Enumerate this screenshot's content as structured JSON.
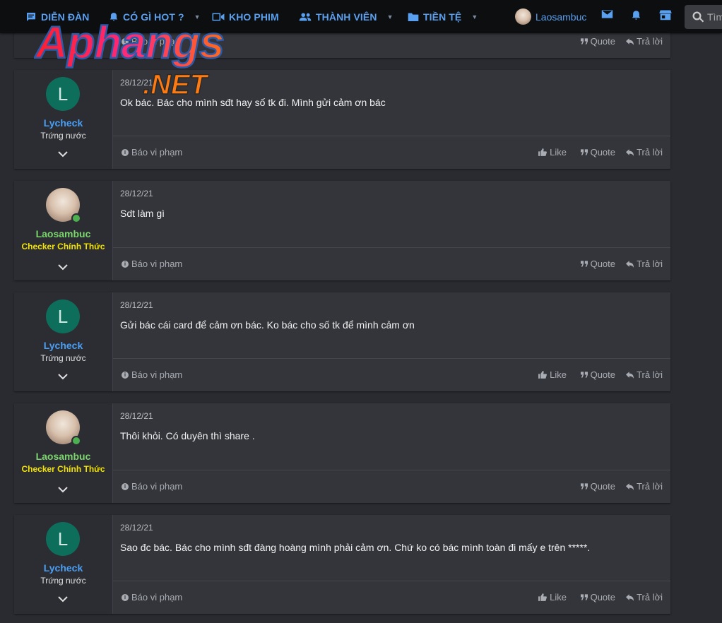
{
  "nav": {
    "forums": "DIỄN ĐÀN",
    "whats_hot": "CÓ GÌ HOT ?",
    "movies": "KHO PHIM",
    "members": "THÀNH VIÊN",
    "currency": "TIỀN TỆ",
    "username": "Laosambuc",
    "search_placeholder": "Tìm"
  },
  "logo": {
    "main": "Aphangs",
    "sub": ".NET"
  },
  "actions": {
    "report": "Báo vi phạm",
    "like": "Like",
    "quote": "Quote",
    "reply": "Trả lời"
  },
  "partial_post": {
    "report": "Báo vi phạm"
  },
  "posts": [
    {
      "user": "Lycheck",
      "title": "Trứng nước",
      "avatar": "L",
      "date": "28/12/21",
      "text": "Ok bác. Bác cho mình sđt hay số tk đi. Mình gửi cảm ơn bác"
    },
    {
      "user": "Laosambuc",
      "title": "Checker Chính Thức",
      "avatar": "",
      "date": "28/12/21",
      "text": "Sdt làm gì"
    },
    {
      "user": "Lycheck",
      "title": "Trứng nước",
      "avatar": "L",
      "date": "28/12/21",
      "text": "Gửi bác cái card để cảm ơn bác. Ko bác cho số tk để mình cảm ơn"
    },
    {
      "user": "Laosambuc",
      "title": "Checker Chính Thức",
      "avatar": "",
      "date": "28/12/21",
      "text": "Thôi khỏi. Có duyên thì share ."
    },
    {
      "user": "Lycheck",
      "title": "Trứng nước",
      "avatar": "L",
      "date": "28/12/21",
      "text": "Sao đc bác. Bác cho mình sđt đàng hoàng mình phải cảm ơn. Chứ ko có bác mình toàn đi mấy e trên *****."
    }
  ],
  "colors": {
    "accent": "#5aa0f0",
    "member_blue": "#4a9ff5",
    "member_green": "#7bd66b",
    "checker_yellow": "#f2e300",
    "letter_avatar": "#0d6e5c"
  }
}
